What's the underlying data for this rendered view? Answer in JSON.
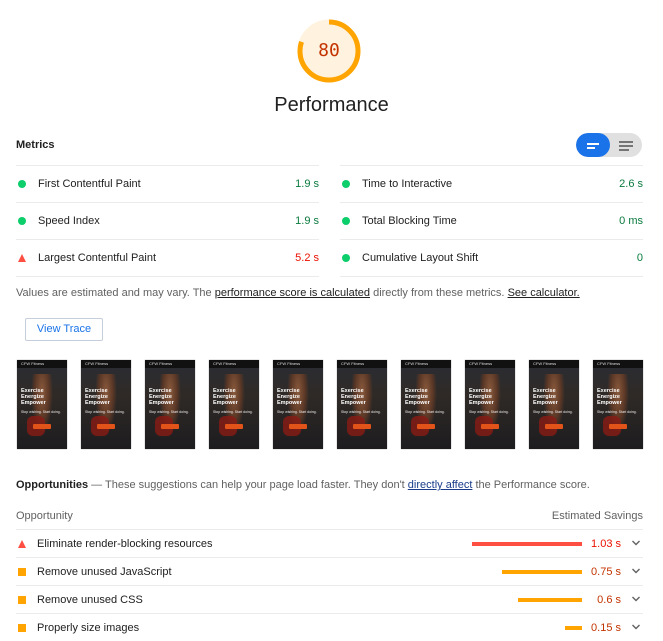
{
  "score": {
    "value": "80",
    "fraction": 0.8,
    "color": "#ffa400"
  },
  "title": "Performance",
  "metrics_header": "Metrics",
  "metrics": [
    {
      "label": "First Contentful Paint",
      "value": "1.9 s",
      "status": "pass"
    },
    {
      "label": "Speed Index",
      "value": "1.9 s",
      "status": "pass"
    },
    {
      "label": "Largest Contentful Paint",
      "value": "5.2 s",
      "status": "fail"
    },
    {
      "label": "Time to Interactive",
      "value": "2.6 s",
      "status": "pass"
    },
    {
      "label": "Total Blocking Time",
      "value": "0 ms",
      "status": "pass"
    },
    {
      "label": "Cumulative Layout Shift",
      "value": "0",
      "status": "pass"
    }
  ],
  "note": {
    "prefix": "Values are estimated and may vary. The ",
    "link1": "performance score is calculated",
    "middle": " directly from these metrics. ",
    "link2": "See calculator."
  },
  "view_trace": "View Trace",
  "filmstrip": {
    "count": 10,
    "nav_text": "CFW Fitness",
    "hero_text": "Exercise Energize Empower",
    "sub_text": "Stop wishing. Start doing.",
    "cta_text": "Join Us"
  },
  "opportunities": {
    "title": "Opportunities",
    "dash": " — ",
    "description_prefix": "These suggestions can help your page load faster. They don't ",
    "description_link": "directly affect",
    "description_suffix": " the Performance score.",
    "col_opportunity": "Opportunity",
    "col_savings": "Estimated Savings",
    "items": [
      {
        "label": "Eliminate render-blocking resources",
        "value": "1.03 s",
        "fraction": 1.0,
        "status": "fail"
      },
      {
        "label": "Remove unused JavaScript",
        "value": "0.75 s",
        "fraction": 0.73,
        "status": "average"
      },
      {
        "label": "Remove unused CSS",
        "value": "0.6 s",
        "fraction": 0.58,
        "status": "average"
      },
      {
        "label": "Properly size images",
        "value": "0.15 s",
        "fraction": 0.15,
        "status": "average"
      }
    ]
  },
  "colors": {
    "pass": "#0cce6b",
    "pass_text": "#0a7a3e",
    "average": "#ffa400",
    "average_text": "#c33300",
    "fail": "#ff4e42",
    "fail_text": "#eb0f00",
    "toggle_active": "#1a73e8"
  }
}
